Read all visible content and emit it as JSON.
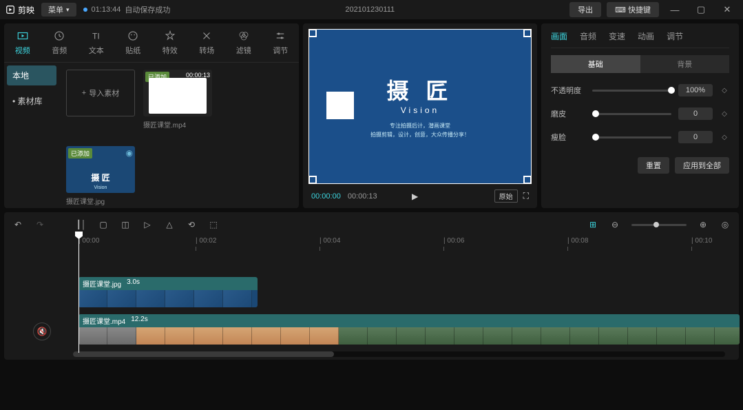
{
  "titlebar": {
    "app_name": "剪映",
    "menu": "菜单",
    "save_time": "01:13:44",
    "save_status": "自动保存成功",
    "project": "202101230111",
    "export": "导出",
    "shortcuts": "快捷键"
  },
  "tools": [
    {
      "label": "视频",
      "active": true
    },
    {
      "label": "音频",
      "active": false
    },
    {
      "label": "文本",
      "active": false
    },
    {
      "label": "贴纸",
      "active": false
    },
    {
      "label": "特效",
      "active": false
    },
    {
      "label": "转场",
      "active": false
    },
    {
      "label": "滤镜",
      "active": false
    },
    {
      "label": "调节",
      "active": false
    }
  ],
  "sidebar": [
    {
      "label": "本地",
      "active": true
    },
    {
      "label": "素材库",
      "active": false
    }
  ],
  "import_label": "导入素材",
  "media": [
    {
      "name": "摄匠课堂.mp4",
      "badge": "已添加",
      "duration": "00:00:13",
      "type": "video"
    },
    {
      "name": "摄匠课堂.jpg",
      "badge": "已添加",
      "type": "image"
    }
  ],
  "preview": {
    "title": "摄 匠",
    "sub": "Vision",
    "desc1": "专注拍摄后计，潜画课堂",
    "desc2": "拍摄剪辑，设计，创意，大众传播分享！",
    "current": "00:00:00",
    "duration": "00:00:13",
    "ratio": "原始"
  },
  "props": {
    "tabs": [
      "画面",
      "音频",
      "变速",
      "动画",
      "调节"
    ],
    "subtabs": [
      "基础",
      "背景"
    ],
    "opacity": {
      "label": "不透明度",
      "value": "100%",
      "pos": 100
    },
    "skin": {
      "label": "磨皮",
      "value": "0",
      "pos": 0
    },
    "face": {
      "label": "瘦脸",
      "value": "0",
      "pos": 0
    },
    "reset": "重置",
    "apply_all": "应用到全部"
  },
  "timeline": {
    "marks": [
      "00:00",
      "00:02",
      "00:04",
      "00:06",
      "00:08",
      "00:10"
    ],
    "clip1": {
      "name": "摄匠课堂.jpg",
      "dur": "3.0s"
    },
    "clip2": {
      "name": "摄匠课堂.mp4",
      "dur": "12.2s"
    }
  }
}
